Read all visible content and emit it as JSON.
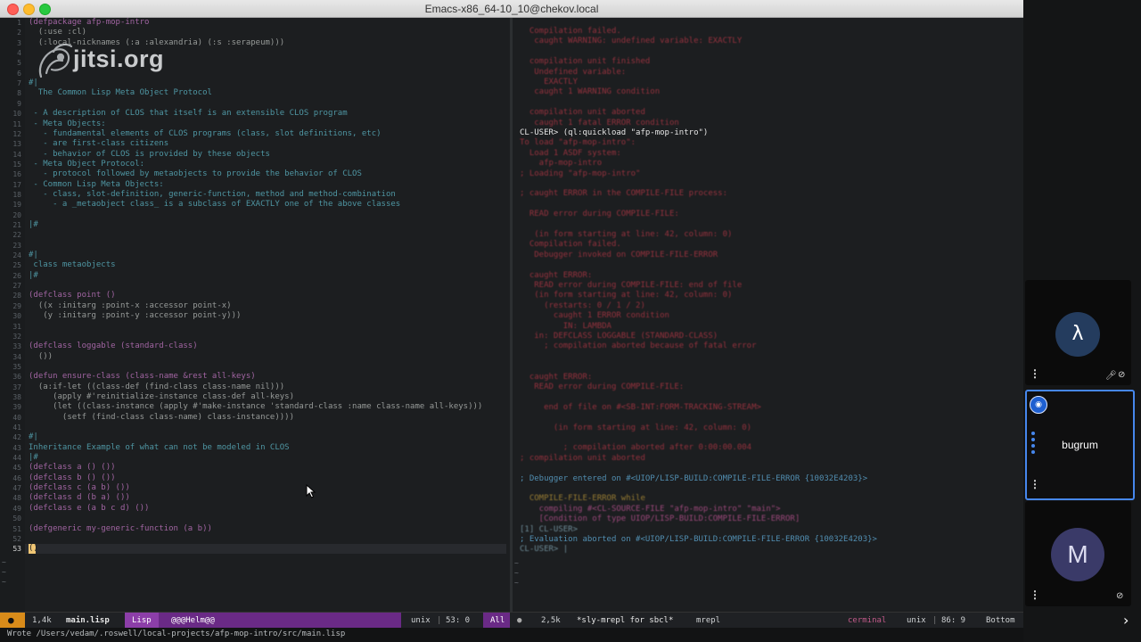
{
  "window": {
    "title": "Emacs-x86_64-10_10@chekov.local"
  },
  "left_pane": {
    "code_lines": [
      {
        "n": "1",
        "text": "(defpackage afp-mop-intro",
        "cls": "kw"
      },
      {
        "n": "2",
        "text": "  (:use :cl)",
        "cls": ""
      },
      {
        "n": "3",
        "text": "  (:local-nicknames (:a :alexandria) (:s :serapeum)))",
        "cls": ""
      },
      {
        "n": "4",
        "text": "",
        "cls": ""
      },
      {
        "n": "5",
        "text": "",
        "cls": ""
      },
      {
        "n": "6",
        "text": "",
        "cls": ""
      },
      {
        "n": "7",
        "text": "#|",
        "cls": "cm"
      },
      {
        "n": "8",
        "text": "  The Common Lisp Meta Object Protocol",
        "cls": "cm"
      },
      {
        "n": "9",
        "text": "",
        "cls": ""
      },
      {
        "n": "10",
        "text": " - A description of CLOS that itself is an extensible CLOS program",
        "cls": "cm"
      },
      {
        "n": "11",
        "text": " - Meta Objects:",
        "cls": "cm"
      },
      {
        "n": "12",
        "text": "   - fundamental elements of CLOS programs (class, slot definitions, etc)",
        "cls": "cm"
      },
      {
        "n": "13",
        "text": "   - are first-class citizens",
        "cls": "cm"
      },
      {
        "n": "14",
        "text": "   - behavior of CLOS is provided by these objects",
        "cls": "cm"
      },
      {
        "n": "15",
        "text": " - Meta Object Protocol:",
        "cls": "cm"
      },
      {
        "n": "16",
        "text": "   - protocol followed by metaobjects to provide the behavior of CLOS",
        "cls": "cm"
      },
      {
        "n": "17",
        "text": " - Common Lisp Meta Objects:",
        "cls": "cm"
      },
      {
        "n": "18",
        "text": "   - class, slot-definition, generic-function, method and method-combination",
        "cls": "cm"
      },
      {
        "n": "19",
        "text": "     - a _metaobject class_ is a subclass of EXACTLY one of the above classes",
        "cls": "cm"
      },
      {
        "n": "20",
        "text": "",
        "cls": ""
      },
      {
        "n": "21",
        "text": "|#",
        "cls": "cm"
      },
      {
        "n": "22",
        "text": "",
        "cls": ""
      },
      {
        "n": "23",
        "text": "",
        "cls": ""
      },
      {
        "n": "24",
        "text": "#|",
        "cls": "cm"
      },
      {
        "n": "25",
        "text": " class metaobjects",
        "cls": "cm"
      },
      {
        "n": "26",
        "text": "|#",
        "cls": "cm"
      },
      {
        "n": "27",
        "text": "",
        "cls": ""
      },
      {
        "n": "28",
        "text": "(defclass point ()",
        "cls": "kw"
      },
      {
        "n": "29",
        "text": "  ((x :initarg :point-x :accessor point-x)",
        "cls": ""
      },
      {
        "n": "30",
        "text": "   (y :initarg :point-y :accessor point-y)))",
        "cls": ""
      },
      {
        "n": "31",
        "text": "",
        "cls": ""
      },
      {
        "n": "32",
        "text": "",
        "cls": ""
      },
      {
        "n": "33",
        "text": "(defclass loggable (standard-class)",
        "cls": "kw"
      },
      {
        "n": "34",
        "text": "  ())",
        "cls": ""
      },
      {
        "n": "35",
        "text": "",
        "cls": ""
      },
      {
        "n": "36",
        "text": "(defun ensure-class (class-name &rest all-keys)",
        "cls": "kw"
      },
      {
        "n": "37",
        "text": "  (a:if-let ((class-def (find-class class-name nil)))",
        "cls": ""
      },
      {
        "n": "38",
        "text": "     (apply #'reinitialize-instance class-def all-keys)",
        "cls": ""
      },
      {
        "n": "39",
        "text": "     (let ((class-instance (apply #'make-instance 'standard-class :name class-name all-keys)))",
        "cls": ""
      },
      {
        "n": "40",
        "text": "       (setf (find-class class-name) class-instance))))",
        "cls": ""
      },
      {
        "n": "41",
        "text": "",
        "cls": ""
      },
      {
        "n": "42",
        "text": "#|",
        "cls": "cm"
      },
      {
        "n": "43",
        "text": "Inheritance Example of what can not be modeled in CLOS",
        "cls": "cm"
      },
      {
        "n": "44",
        "text": "|#",
        "cls": "cm"
      },
      {
        "n": "45",
        "text": "(defclass a () ())",
        "cls": "kw"
      },
      {
        "n": "46",
        "text": "(defclass b () ())",
        "cls": "kw"
      },
      {
        "n": "47",
        "text": "(defclass c (a b) ())",
        "cls": "kw"
      },
      {
        "n": "48",
        "text": "(defclass d (b a) ())",
        "cls": "kw"
      },
      {
        "n": "49",
        "text": "(defclass e (a b c d) ())",
        "cls": "kw"
      },
      {
        "n": "50",
        "text": "",
        "cls": ""
      },
      {
        "n": "51",
        "text": "(defgeneric my-generic-function (a b))",
        "cls": "kw"
      },
      {
        "n": "52",
        "text": "",
        "cls": ""
      },
      {
        "n": "53",
        "text": "()",
        "cls": "cur"
      }
    ]
  },
  "right_pane": {
    "lines": [
      {
        "text": "  Compilation failed.",
        "cls": ""
      },
      {
        "text": "   caught WARNING: undefined variable: EXACTLY",
        "cls": ""
      },
      {
        "text": "",
        "cls": ""
      },
      {
        "text": "  compilation unit finished",
        "cls": ""
      },
      {
        "text": "   Undefined variable:",
        "cls": ""
      },
      {
        "text": "     EXACTLY",
        "cls": ""
      },
      {
        "text": "   caught 1 WARNING condition",
        "cls": ""
      },
      {
        "text": "",
        "cls": ""
      },
      {
        "text": "  compilation unit aborted",
        "cls": ""
      },
      {
        "text": "   caught 1 fatal ERROR condition",
        "cls": ""
      },
      {
        "text": "CL-USER> (ql:quickload \"afp-mop-intro\")",
        "cls": "bright"
      },
      {
        "text": "To load \"afp-mop-intro\":",
        "cls": ""
      },
      {
        "text": "  Load 1 ASDF system:",
        "cls": ""
      },
      {
        "text": "    afp-mop-intro",
        "cls": ""
      },
      {
        "text": "; Loading \"afp-mop-intro\"",
        "cls": ""
      },
      {
        "text": "",
        "cls": ""
      },
      {
        "text": "; caught ERROR in the COMPILE-FILE process:",
        "cls": ""
      },
      {
        "text": "",
        "cls": ""
      },
      {
        "text": "  READ error during COMPILE-FILE:",
        "cls": ""
      },
      {
        "text": "",
        "cls": ""
      },
      {
        "text": "   (in form starting at line: 42, column: 0)",
        "cls": ""
      },
      {
        "text": "  Compilation failed.",
        "cls": ""
      },
      {
        "text": "   Debugger invoked on COMPILE-FILE-ERROR",
        "cls": ""
      },
      {
        "text": "",
        "cls": ""
      },
      {
        "text": "  caught ERROR:",
        "cls": ""
      },
      {
        "text": "   READ error during COMPILE-FILE: end of file",
        "cls": ""
      },
      {
        "text": "   (in form starting at line: 42, column: 0)",
        "cls": ""
      },
      {
        "text": "     (restarts: 0 / 1 / 2)",
        "cls": ""
      },
      {
        "text": "       caught 1 ERROR condition",
        "cls": ""
      },
      {
        "text": "         IN: LAMBDA",
        "cls": ""
      },
      {
        "text": "   in: DEFCLASS LOGGABLE (STANDARD-CLASS)",
        "cls": ""
      },
      {
        "text": "     ; compilation aborted because of fatal error",
        "cls": ""
      },
      {
        "text": "",
        "cls": ""
      },
      {
        "text": "",
        "cls": ""
      },
      {
        "text": "  caught ERROR:",
        "cls": ""
      },
      {
        "text": "   READ error during COMPILE-FILE:",
        "cls": ""
      },
      {
        "text": "",
        "cls": ""
      },
      {
        "text": "     end of file on #<SB-INT:FORM-TRACKING-STREAM>",
        "cls": ""
      },
      {
        "text": "",
        "cls": ""
      },
      {
        "text": "       (in form starting at line: 42, column: 0)",
        "cls": ""
      },
      {
        "text": "",
        "cls": ""
      },
      {
        "text": "         ; compilation aborted after 0:00:00.004",
        "cls": ""
      },
      {
        "text": "; compilation unit aborted",
        "cls": ""
      },
      {
        "text": "",
        "cls": ""
      },
      {
        "text": "; Debugger entered on #<UIOP/LISP-BUILD:COMPILE-FILE-ERROR {10032E4203}>",
        "cls": "cyan"
      },
      {
        "text": "",
        "cls": ""
      },
      {
        "text": "  COMPILE-FILE-ERROR while",
        "cls": "yel"
      },
      {
        "text": "    compiling #<CL-SOURCE-FILE \"afp-mop-intro\" \"main\">",
        "cls": "pink"
      },
      {
        "text": "    [Condition of type UIOP/LISP-BUILD:COMPILE-FILE-ERROR]",
        "cls": "pink"
      },
      {
        "text": "[1] CL-USER>",
        "cls": "prompt"
      },
      {
        "text": "; Evaluation aborted on #<UIOP/LISP-BUILD:COMPILE-FILE-ERROR {10032E4203}>",
        "cls": "cyan"
      },
      {
        "text": "CL-USER> |",
        "cls": "prompt"
      }
    ]
  },
  "modeline": {
    "left": {
      "size": "1,4k",
      "file": "main.lisp",
      "mode": "Lisp",
      "helm": "@@@Helm@@",
      "encoding": "unix",
      "position": "53: 0",
      "scroll": "All"
    },
    "right": {
      "size": "2,5k",
      "buffer": "*sly-mrepl for sbcl*",
      "mode": "mrepl",
      "host": "cerminal",
      "encoding": "unix",
      "position": "86: 9",
      "scroll": "Bottom"
    }
  },
  "minibuffer": {
    "text": "Wrote /Users/vedam/.roswell/local-projects/afp-mop-intro/src/main.lisp"
  },
  "jitsi": {
    "watermark": "jitsi.org"
  },
  "participants": [
    {
      "avatar": "λ",
      "name": ""
    },
    {
      "avatar": "",
      "name": "bugrum"
    },
    {
      "avatar": "M",
      "name": ""
    }
  ],
  "icons": {
    "more": "⋮",
    "mic_off": "🎤︎",
    "cam_off": "⊘",
    "next": "›",
    "badge": "◉"
  },
  "colors": {
    "accent": "#4687ed",
    "cursor": "#f0c674",
    "modeline_purple": "#8c3ea8",
    "warn": "#d88b1a"
  }
}
